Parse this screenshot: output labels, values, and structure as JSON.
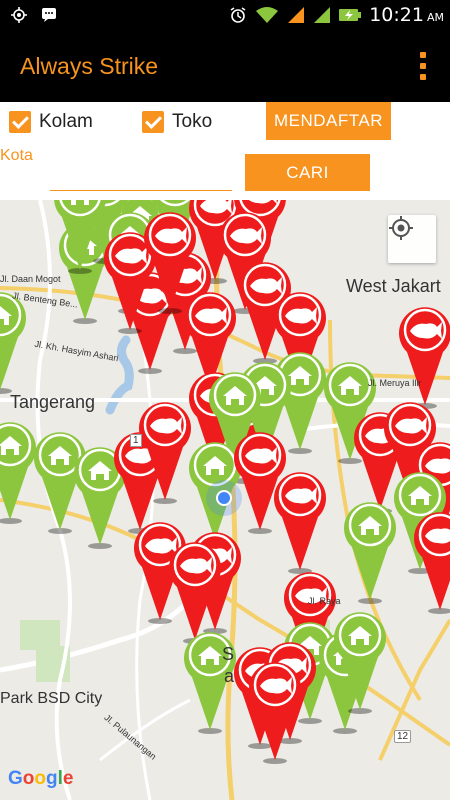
{
  "status_bar": {
    "time": "10:21",
    "ampm": "AM",
    "icons": [
      "gps-icon",
      "bbm-icon",
      "alarm-icon",
      "wifi-icon",
      "signal-orange-icon",
      "signal-green-icon",
      "battery-charging-icon"
    ]
  },
  "app": {
    "title": "Always Strike",
    "menu_icon": "overflow-menu-icon"
  },
  "filters": {
    "kolam": {
      "label": "Kolam",
      "checked": true
    },
    "toko": {
      "label": "Toko",
      "checked": true
    },
    "register_button": "MENDAFTAR",
    "city_label": "Kota",
    "city_value": "",
    "search_button": "CARI"
  },
  "map": {
    "labels": {
      "west_jakarta": "West Jakart",
      "tangerang": "Tangerang",
      "park_bsd": "Park BSD City",
      "daan_mogot": "Jl. Daan Mogot",
      "benteng": "Jl. Benteng Be...",
      "hasyim": "Jl. Kh. Hasyim Ashari",
      "meruya": "Jl. Meruya Ilir",
      "pulaunangan": "Jl. Pulaunangan",
      "raya": "Jl. Raya",
      "s_fragment": "S",
      "a_fragment": "a",
      "road_1": "1",
      "road_12": "12"
    },
    "attribution": "Google",
    "pond_marker_color": "#ee1c1c",
    "shop_marker_color": "#8cc63f",
    "my_location_color": "#4285f4",
    "accent_color": "#f7931e"
  }
}
